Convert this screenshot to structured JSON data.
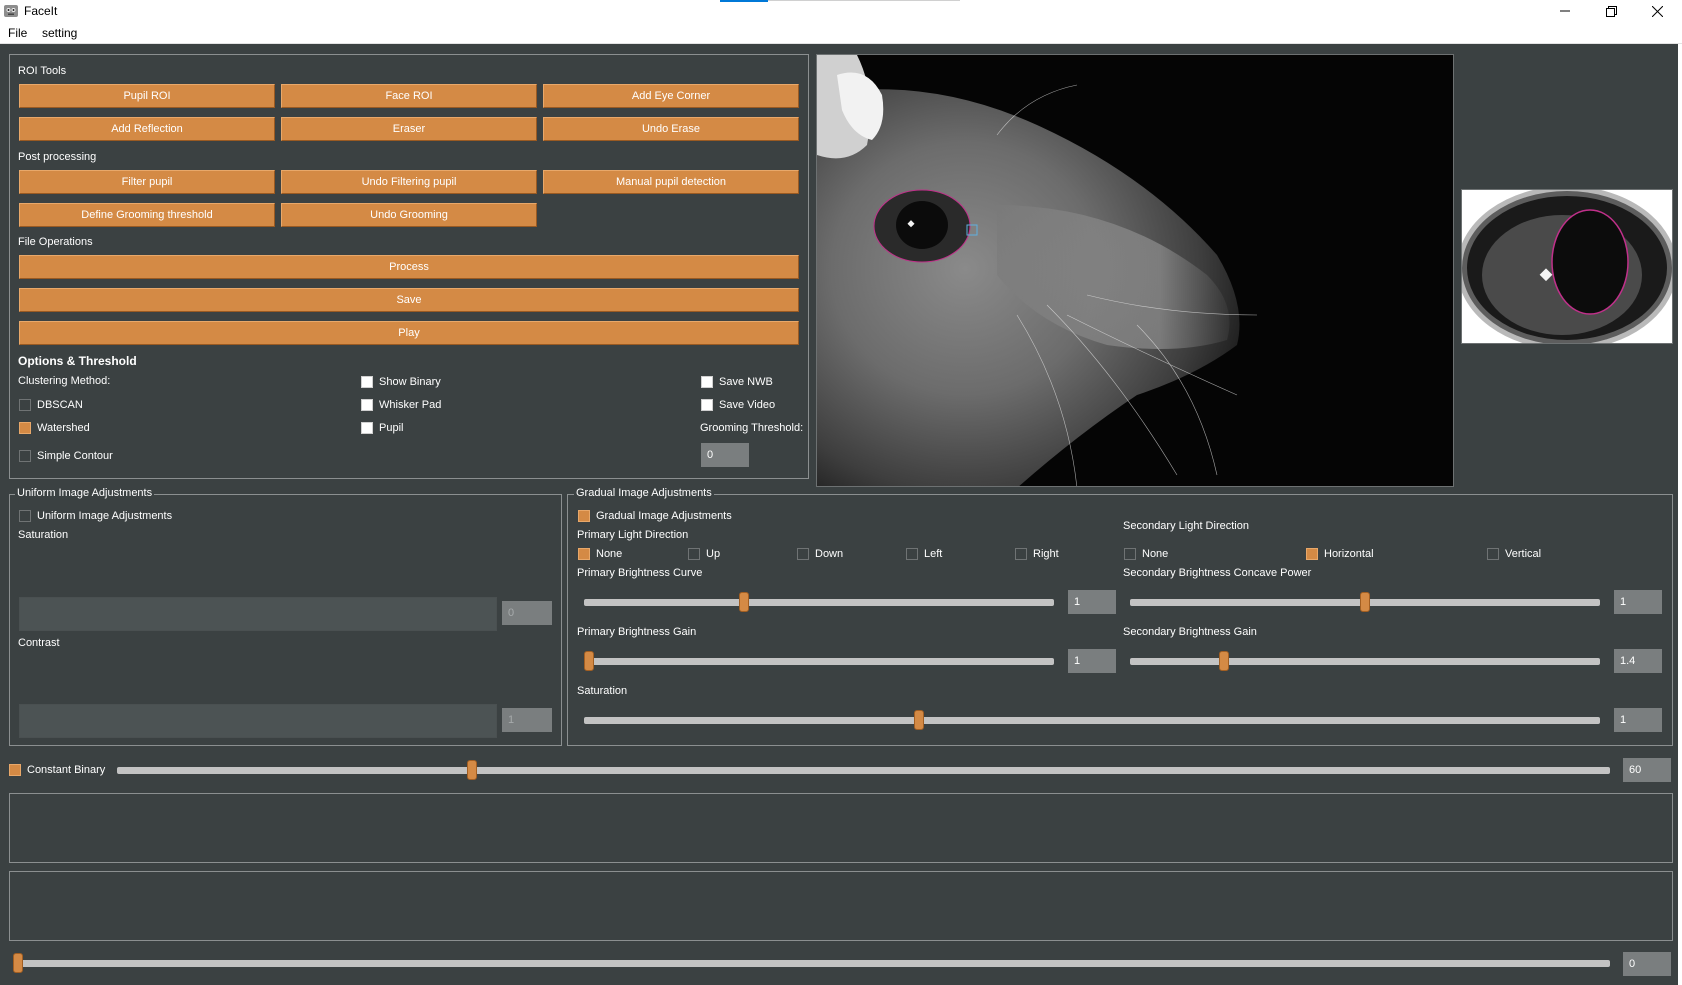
{
  "app": {
    "title": "FaceIt",
    "icon": "app-icon"
  },
  "window_controls": {
    "minimize": "minimize-icon",
    "maximize": "restore-icon",
    "close": "close-icon"
  },
  "menu": [
    "File",
    "setting"
  ],
  "roi_tools": {
    "title": "ROI Tools",
    "buttons": [
      "Pupil ROI",
      "Face ROI",
      "Add Eye Corner",
      "Add Reflection",
      "Eraser",
      "Undo Erase"
    ]
  },
  "post_processing": {
    "title": "Post processing",
    "buttons": [
      "Filter pupil",
      "Undo Filtering pupil",
      "Manual pupil detection",
      "Define Grooming threshold",
      "Undo Grooming"
    ]
  },
  "file_operations": {
    "title": "File Operations",
    "buttons": [
      "Process",
      "Save",
      "Play"
    ]
  },
  "options": {
    "title": "Options & Threshold",
    "clustering_label": "Clustering Method:",
    "dbscan": {
      "label": "DBSCAN",
      "checked": false
    },
    "watershed": {
      "label": "Watershed",
      "checked": true
    },
    "simple_contour": {
      "label": "Simple Contour",
      "checked": false
    },
    "show_binary": {
      "label": "Show Binary",
      "checked": false
    },
    "whisker_pad": {
      "label": "Whisker Pad",
      "checked": false
    },
    "pupil": {
      "label": "Pupil",
      "checked": false
    },
    "save_nwb": {
      "label": "Save NWB",
      "checked": false
    },
    "save_video": {
      "label": "Save Video",
      "checked": false
    },
    "grooming_label": "Grooming Threshold:",
    "grooming_value": "0"
  },
  "uniform": {
    "legend": "Uniform Image Adjustments",
    "checkbox": {
      "label": "Uniform Image Adjustments",
      "checked": false
    },
    "saturation_label": "Saturation",
    "saturation_value": "0",
    "contrast_label": "Contrast",
    "contrast_value": "1"
  },
  "gradual": {
    "legend": "Gradual Image Adjustments",
    "checkbox": {
      "label": "Gradual Image Adjustments",
      "checked": true
    },
    "primary_direction_label": "Primary Light Direction",
    "primary_directions": [
      {
        "label": "None",
        "checked": true
      },
      {
        "label": "Up",
        "checked": false
      },
      {
        "label": "Down",
        "checked": false
      },
      {
        "label": "Left",
        "checked": false
      },
      {
        "label": "Right",
        "checked": false
      }
    ],
    "secondary_direction_label": "Secondary Light Direction",
    "secondary_directions": [
      {
        "label": "None",
        "checked": false
      },
      {
        "label": "Horizontal",
        "checked": true
      },
      {
        "label": "Vertical",
        "checked": false
      }
    ],
    "primary_curve": {
      "label": "Primary Brightness Curve",
      "value": "1",
      "position": 0.34
    },
    "primary_gain": {
      "label": "Primary Brightness Gain",
      "value": "1",
      "position": 0.01
    },
    "secondary_power": {
      "label": "Secondary Brightness Concave Power",
      "value": "1",
      "position": 0.5
    },
    "secondary_gain": {
      "label": "Secondary Brightness Gain",
      "value": "1.4",
      "position": 0.2
    },
    "saturation": {
      "label": "Saturation",
      "value": "1",
      "position": 0.33
    }
  },
  "constant_binary": {
    "label": "Constant Binary",
    "checked": true,
    "value": "60",
    "position": 0.238
  },
  "frame_slider": {
    "value": "0",
    "position": 0.0
  },
  "colors": {
    "accent": "#d48a45",
    "background": "#3b4142",
    "track": "#c3c3c3",
    "input": "#7a7e7f",
    "pupil_ellipse": "#c0308a"
  }
}
